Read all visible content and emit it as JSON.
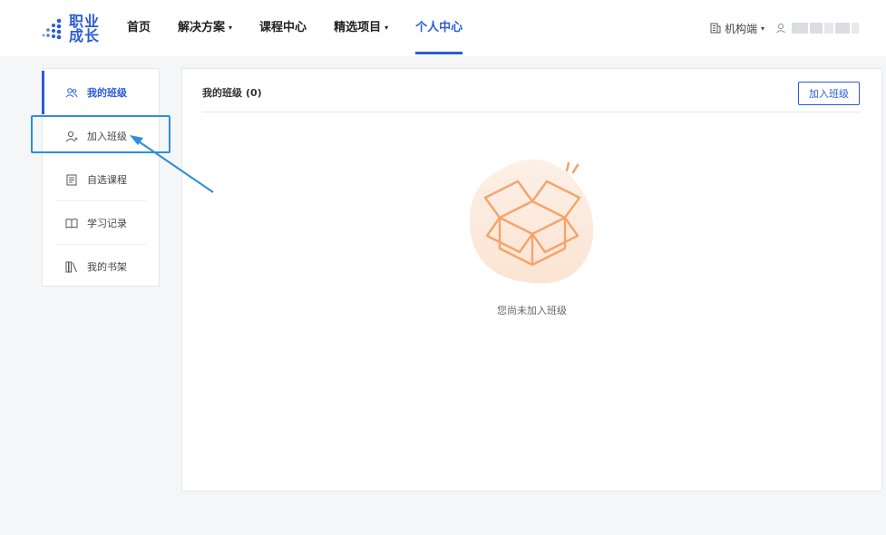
{
  "header": {
    "logo": {
      "line1": "职业",
      "line2": "成长"
    },
    "nav": [
      {
        "label": "首页",
        "has_caret": false
      },
      {
        "label": "解决方案",
        "has_caret": true
      },
      {
        "label": "课程中心",
        "has_caret": false
      },
      {
        "label": "精选项目",
        "has_caret": true
      },
      {
        "label": "个人中心",
        "has_caret": false,
        "active": true
      }
    ],
    "org_label": "机构端",
    "caret": "▾"
  },
  "sidebar": {
    "items": [
      {
        "label": "我的班级",
        "icon": "users-icon",
        "active": true
      },
      {
        "label": "加入班级",
        "icon": "user-add-icon"
      },
      {
        "label": "自选课程",
        "icon": "document-icon"
      },
      {
        "label": "学习记录",
        "icon": "book-open-icon"
      },
      {
        "label": "我的书架",
        "icon": "bookshelf-icon"
      }
    ]
  },
  "main": {
    "title": "我的班级",
    "count": "(0)",
    "join_button": "加入班级",
    "empty_text": "您尚未加入班级"
  },
  "colors": {
    "accent": "#2a5bd7",
    "highlight": "#2d8ee0",
    "illustration": "#f5a46a"
  }
}
